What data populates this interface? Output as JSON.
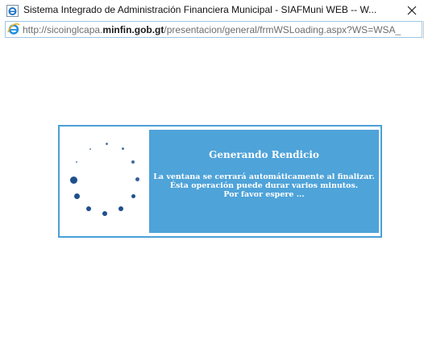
{
  "window": {
    "title": "Sistema Integrado de Administración Financiera Municipal - SIAFMuni WEB -- W...",
    "close_label": "✕"
  },
  "address": {
    "url_prefix": "http://sicoinglcapa.",
    "url_domain": "minfin.gob.gt",
    "url_suffix": "/presentacion/general/frmWSLoading.aspx?WS=WSA_"
  },
  "loading": {
    "title": "Generando Rendicio",
    "line1": "La ventana se cerrará automáticamente al finalizar.",
    "line2": "Ésta operación puede durar varios minutos.",
    "line3": "Por favor espere ..."
  },
  "icons": {
    "title_icon": "ie-page-icon",
    "address_icon": "internet-explorer-icon",
    "spinner": "loading-spinner-icon"
  },
  "colors": {
    "accent": "#4ea3d9",
    "border": "#4aa0d8",
    "spinner_dot": "#1f4f8c"
  }
}
